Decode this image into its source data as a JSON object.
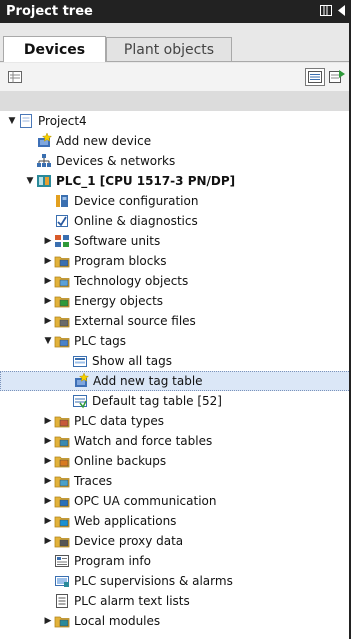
{
  "window": {
    "title": "Project tree"
  },
  "tabs": [
    {
      "label": "Devices"
    },
    {
      "label": "Plant objects"
    }
  ],
  "tree": [
    {
      "label": "Project4",
      "level": 0,
      "arrow": "down",
      "icon": "project-icon"
    },
    {
      "label": "Add new device",
      "level": 1,
      "arrow": "none",
      "icon": "add-device-icon"
    },
    {
      "label": "Devices & networks",
      "level": 1,
      "arrow": "none",
      "icon": "network-icon"
    },
    {
      "label": "PLC_1 [CPU 1517-3 PN/DP]",
      "level": 1,
      "arrow": "down",
      "icon": "plc-icon",
      "bold": true
    },
    {
      "label": "Device configuration",
      "level": 2,
      "arrow": "none",
      "icon": "device-config-icon"
    },
    {
      "label": "Online & diagnostics",
      "level": 2,
      "arrow": "none",
      "icon": "diagnostics-icon"
    },
    {
      "label": "Software units",
      "level": 2,
      "arrow": "right",
      "icon": "software-units-icon"
    },
    {
      "label": "Program blocks",
      "level": 2,
      "arrow": "right",
      "icon": "folder-blocks-icon"
    },
    {
      "label": "Technology objects",
      "level": 2,
      "arrow": "right",
      "icon": "folder-technology-icon"
    },
    {
      "label": "Energy objects",
      "level": 2,
      "arrow": "right",
      "icon": "folder-energy-icon"
    },
    {
      "label": "External source files",
      "level": 2,
      "arrow": "right",
      "icon": "folder-source-icon"
    },
    {
      "label": "PLC tags",
      "level": 2,
      "arrow": "down",
      "icon": "folder-tags-icon"
    },
    {
      "label": "Show all tags",
      "level": 3,
      "arrow": "none",
      "icon": "show-tags-icon"
    },
    {
      "label": "Add new tag table",
      "level": 3,
      "arrow": "none",
      "icon": "add-tag-table-icon",
      "selected": true
    },
    {
      "label": "Default tag table [52]",
      "level": 3,
      "arrow": "none",
      "icon": "tag-table-icon"
    },
    {
      "label": "PLC data types",
      "level": 2,
      "arrow": "right",
      "icon": "folder-datatypes-icon"
    },
    {
      "label": "Watch and force tables",
      "level": 2,
      "arrow": "right",
      "icon": "folder-watch-icon"
    },
    {
      "label": "Online backups",
      "level": 2,
      "arrow": "right",
      "icon": "folder-backup-icon"
    },
    {
      "label": "Traces",
      "level": 2,
      "arrow": "right",
      "icon": "folder-traces-icon"
    },
    {
      "label": "OPC UA communication",
      "level": 2,
      "arrow": "right",
      "icon": "folder-opcua-icon"
    },
    {
      "label": "Web applications",
      "level": 2,
      "arrow": "right",
      "icon": "folder-web-icon"
    },
    {
      "label": "Device proxy data",
      "level": 2,
      "arrow": "right",
      "icon": "folder-proxy-icon"
    },
    {
      "label": "Program info",
      "level": 2,
      "arrow": "none",
      "icon": "program-info-icon"
    },
    {
      "label": "PLC supervisions & alarms",
      "level": 2,
      "arrow": "none",
      "icon": "supervision-icon"
    },
    {
      "label": "PLC alarm text lists",
      "level": 2,
      "arrow": "none",
      "icon": "text-list-icon"
    },
    {
      "label": "Local modules",
      "level": 2,
      "arrow": "right",
      "icon": "folder-modules-icon"
    }
  ],
  "colors": {
    "titlebar": "#222222",
    "selection": "#dbe7f7",
    "folder": "#e2b23a"
  }
}
